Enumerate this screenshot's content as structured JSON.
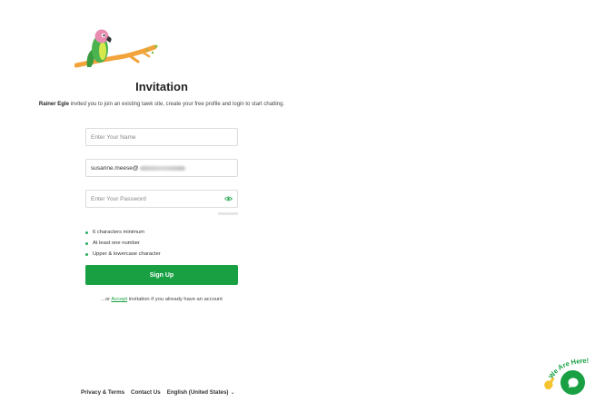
{
  "page": {
    "title": "Invitation",
    "inviter": "Rainer Egle",
    "invite_text": "invited you to join an existing tawk site, create your free profile and login to start chatting."
  },
  "form": {
    "name_placeholder": "Enter Your Name",
    "email_value": "susanne.meese@",
    "password_placeholder": "Enter Your Password",
    "password_rules": [
      "6 characters minimum",
      "At least one number",
      "Upper & lowercase character"
    ],
    "signup_label": "Sign Up"
  },
  "accept": {
    "prefix": "...or",
    "link": "Accept",
    "suffix": "invitation if you already have an account"
  },
  "footer": {
    "privacy": "Privacy & Terms",
    "contact": "Contact Us",
    "language": "English (United States)"
  },
  "chat_widget": {
    "badge_text": "We Are Here!",
    "icon": "chat-bubble-icon"
  },
  "colors": {
    "accent": "#18a043",
    "rule_dot": "#27ae60"
  }
}
